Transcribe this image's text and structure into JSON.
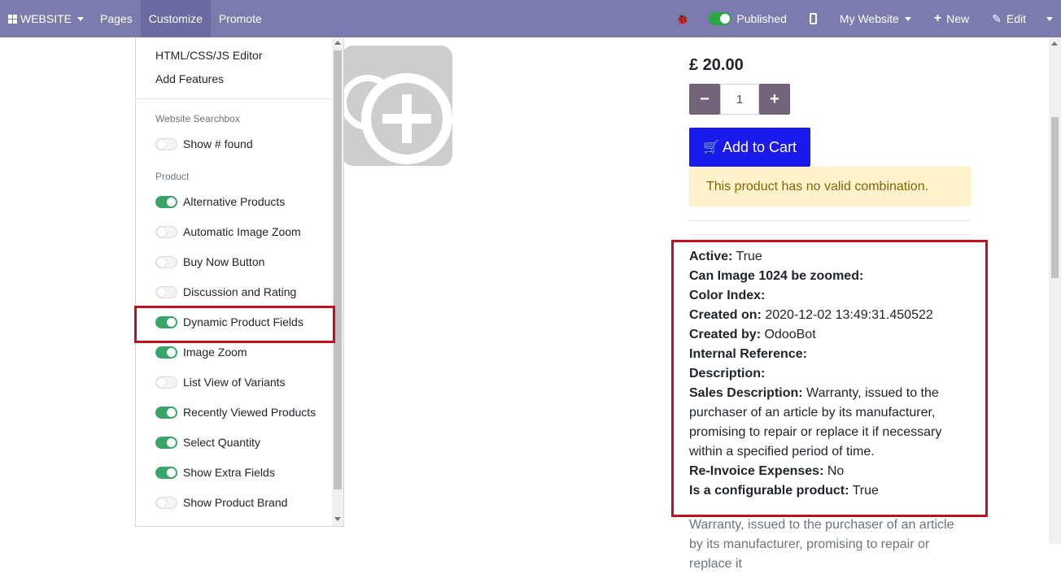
{
  "navbar": {
    "brand": "WEBSITE",
    "pages": "Pages",
    "customize": "Customize",
    "promote": "Promote",
    "published": "Published",
    "my_website": "My Website",
    "new": "New",
    "edit": "Edit"
  },
  "customize_menu": {
    "editor": "HTML/CSS/JS Editor",
    "add_features": "Add Features",
    "sections": [
      {
        "header": "Website Searchbox"
      },
      {
        "header": "Product"
      }
    ],
    "options": [
      {
        "label": "Show # found",
        "enabled": false
      },
      {
        "label": "Alternative Products",
        "enabled": true
      },
      {
        "label": "Automatic Image Zoom",
        "enabled": false
      },
      {
        "label": "Buy Now Button",
        "enabled": false
      },
      {
        "label": "Discussion and Rating",
        "enabled": false
      },
      {
        "label": "Dynamic Product Fields",
        "enabled": true
      },
      {
        "label": "Image Zoom",
        "enabled": true
      },
      {
        "label": "List View of Variants",
        "enabled": false
      },
      {
        "label": "Recently Viewed Products",
        "enabled": true
      },
      {
        "label": "Select Quantity",
        "enabled": true
      },
      {
        "label": "Show Extra Fields",
        "enabled": true
      },
      {
        "label": "Show Product Brand",
        "enabled": false
      }
    ]
  },
  "product": {
    "price": "£ 20.00",
    "quantity": "1",
    "add_to_cart": "Add to Cart",
    "alert": "This product has no valid combination.",
    "fields": [
      {
        "label": "Active:",
        "value": " True"
      },
      {
        "label": "Can Image 1024 be zoomed:",
        "value": ""
      },
      {
        "label": "Color Index:",
        "value": ""
      },
      {
        "label": "Created on:",
        "value": " 2020-12-02 13:49:31.450522"
      },
      {
        "label": "Created by:",
        "value": " OdooBot"
      },
      {
        "label": "Internal Reference:",
        "value": ""
      },
      {
        "label": "Description:",
        "value": ""
      },
      {
        "label": "Sales Description:",
        "value": " Warranty, issued to the purchaser of an article by its manufacturer, promising to repair or replace it if necessary within a specified period of time."
      },
      {
        "label": "Re-Invoice Expenses:",
        "value": " No"
      },
      {
        "label": "Is a configurable product:",
        "value": " True"
      }
    ],
    "description": "Warranty, issued to the purchaser of an article by its manufacturer, promising to repair or replace it"
  },
  "colors": {
    "navbar": "#7c7bad",
    "toggle_on": "#3aa56a",
    "add_to_cart": "#1a1aef",
    "highlight": "#c0111f"
  }
}
